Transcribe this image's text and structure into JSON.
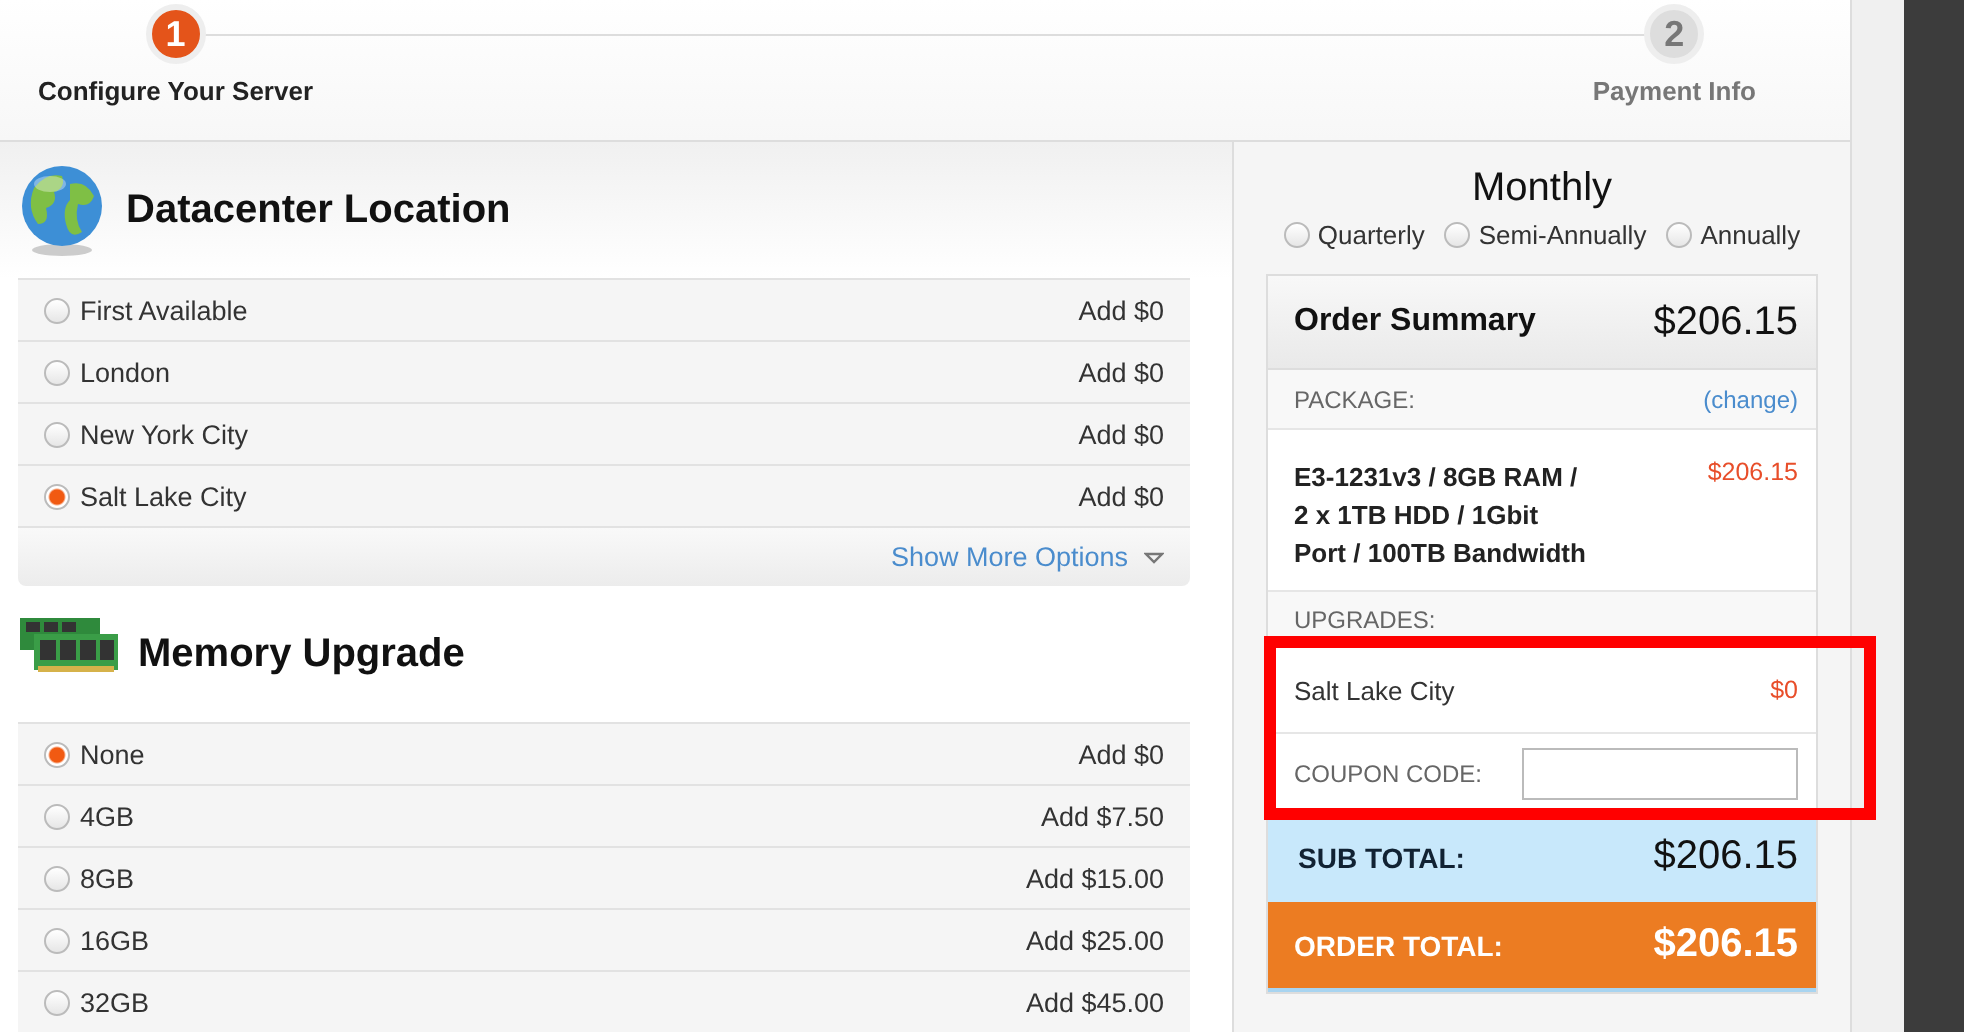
{
  "steps": [
    {
      "number": "1",
      "label": "Configure Your Server",
      "selected": true
    },
    {
      "number": "2",
      "label": "Payment Info",
      "selected": false
    }
  ],
  "sections": [
    {
      "title": "Datacenter Location",
      "kind": "globe",
      "options": [
        {
          "label": "First Available",
          "price": "Add $0",
          "selected": false
        },
        {
          "label": "London",
          "price": "Add $0",
          "selected": false
        },
        {
          "label": "New York City",
          "price": "Add $0",
          "selected": false
        },
        {
          "label": "Salt Lake City",
          "price": "Add $0",
          "selected": true
        }
      ],
      "more_link": "Show More Options"
    },
    {
      "title": "Memory Upgrade",
      "kind": "memory",
      "options": [
        {
          "label": "None",
          "price": "Add $0",
          "selected": true
        },
        {
          "label": "4GB",
          "price": "Add $7.50",
          "selected": false
        },
        {
          "label": "8GB",
          "price": "Add $15.00",
          "selected": false
        },
        {
          "label": "16GB",
          "price": "Add $25.00",
          "selected": false
        },
        {
          "label": "32GB",
          "price": "Add $45.00",
          "selected": false
        }
      ]
    }
  ],
  "billing": {
    "current": "Monthly",
    "cycles": [
      {
        "label": "Quarterly",
        "selected": false
      },
      {
        "label": "Semi-Annually",
        "selected": false
      },
      {
        "label": "Annually",
        "selected": false
      }
    ]
  },
  "summary": {
    "title": "Order Summary",
    "total": "$206.15",
    "package_label": "PACKAGE:",
    "change_link": "(change)",
    "package": "E3-1231v3 / 8GB RAM / 2 x 1TB HDD / 1Gbit Port / 100TB Bandwidth",
    "package_price": "$206.15",
    "upgrades_label": "UPGRADES:",
    "upgrades": [
      {
        "label": "Salt Lake City",
        "price": "$0"
      }
    ],
    "coupon_label": "COUPON CODE:",
    "subtotal_label": "SUB TOTAL:",
    "subtotal": "$206.15",
    "order_total_label": "ORDER TOTAL:",
    "order_total": "$206.15"
  }
}
